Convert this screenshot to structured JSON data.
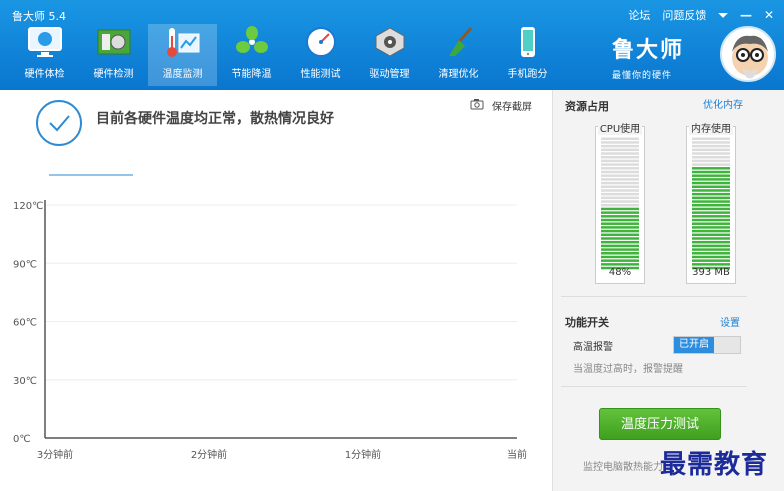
{
  "app": {
    "title": "鲁大师 5.4"
  },
  "window": {
    "forum": "论坛",
    "feedback": "问题反馈",
    "menu_glyph": "⏷",
    "min_glyph": "—",
    "close_glyph": "✕"
  },
  "tabs": [
    {
      "label": "硬件体检",
      "icon": "monitor-icon"
    },
    {
      "label": "硬件检测",
      "icon": "board-icon"
    },
    {
      "label": "温度监测",
      "icon": "thermometer-icon"
    },
    {
      "label": "节能降温",
      "icon": "fan-icon"
    },
    {
      "label": "性能测试",
      "icon": "gauge-icon"
    },
    {
      "label": "驱动管理",
      "icon": "drive-icon"
    },
    {
      "label": "清理优化",
      "icon": "broom-icon"
    },
    {
      "label": "手机跑分",
      "icon": "phone-icon"
    }
  ],
  "active_tab": "温度监测",
  "brand": {
    "name": "鲁大师",
    "slogan": "最懂你的硬件"
  },
  "status": {
    "text": "目前各硬件温度均正常，散热情况良好"
  },
  "screenshot_button": "保存截屏",
  "chart_data": {
    "type": "line",
    "y_ticks": [
      "0℃",
      "30℃",
      "60℃",
      "90℃",
      "120℃"
    ],
    "x_ticks": [
      "3分钟前",
      "2分钟前",
      "1分钟前",
      "当前"
    ],
    "ylim": [
      0,
      120
    ],
    "series": []
  },
  "resources": {
    "title": "资源占用",
    "optimize_link": "优化内存",
    "cpu": {
      "label": "CPU使用",
      "value": "48%",
      "percent": 48
    },
    "memory": {
      "label": "内存使用",
      "value": "393 MB",
      "percent": 79
    }
  },
  "features": {
    "title": "功能开关",
    "settings_link": "设置",
    "alarm_label": "高温报警",
    "alarm_state": "已开启",
    "alarm_desc": "当温度过高时，报警提醒"
  },
  "stress_test": {
    "button": "温度压力测试",
    "desc": "监控电脑散热能力"
  },
  "watermark": "最需教育",
  "colors": {
    "header": "#0f84d8",
    "accent": "#2e8ad3",
    "bar_green": "#3fb43c",
    "button_green": "#4caf2a"
  }
}
